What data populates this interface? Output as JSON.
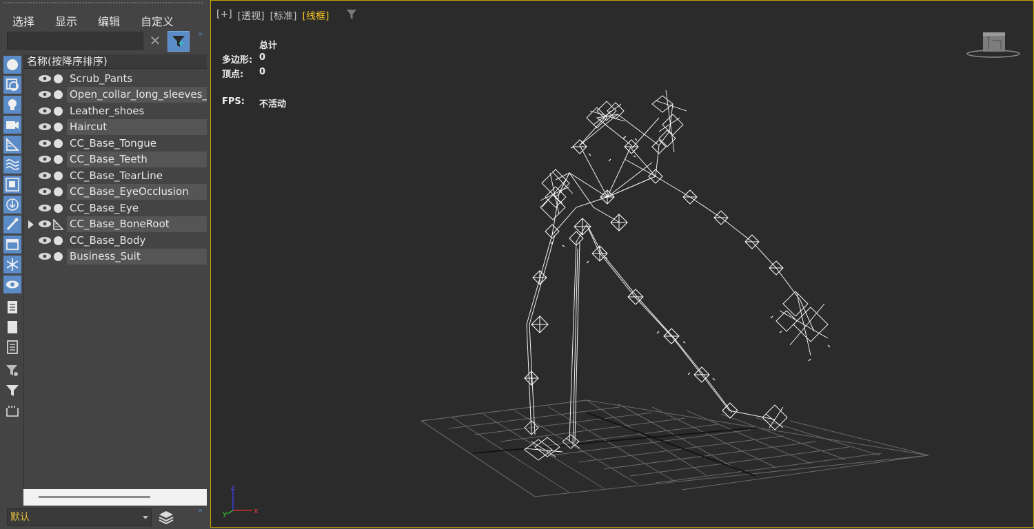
{
  "menu": [
    "选择",
    "显示",
    "编辑",
    "自定义"
  ],
  "search": {
    "value": "",
    "placeholder": ""
  },
  "tree": {
    "header": "名称(按降序排序)",
    "items": [
      {
        "label": "Scrub_Pants",
        "icon": "sphere-icon"
      },
      {
        "label": "Open_collar_long_sleeves_sh",
        "icon": "sphere-icon"
      },
      {
        "label": "Leather_shoes",
        "icon": "sphere-icon"
      },
      {
        "label": "Haircut",
        "icon": "sphere-icon"
      },
      {
        "label": "CC_Base_Tongue",
        "icon": "sphere-icon"
      },
      {
        "label": "CC_Base_Teeth",
        "icon": "sphere-icon"
      },
      {
        "label": "CC_Base_TearLine",
        "icon": "sphere-icon"
      },
      {
        "label": "CC_Base_EyeOcclusion",
        "icon": "sphere-icon"
      },
      {
        "label": "CC_Base_Eye",
        "icon": "sphere-icon"
      },
      {
        "label": "CC_Base_BoneRoot",
        "icon": "bone-icon",
        "expandable": true
      },
      {
        "label": "CC_Base_Body",
        "icon": "sphere-icon"
      },
      {
        "label": "Business_Suit",
        "icon": "sphere-icon"
      }
    ]
  },
  "layer": {
    "value": "默认"
  },
  "viewport": {
    "labels": [
      "[+]",
      "[透视]",
      "[标准]",
      "[线框]"
    ],
    "stats": {
      "header": "总计",
      "polygons_label": "多边形:",
      "polygons_value": "0",
      "vertices_label": "顶点:",
      "vertices_value": "0",
      "fps_label": "FPS:",
      "fps_value": "不活动"
    },
    "axes": {
      "x": "x",
      "y": "y",
      "z": "z"
    }
  },
  "colors": {
    "accent_blue": "#5b8cc8",
    "active_viewport_border": "#c9a200",
    "active_label": "#f0c020",
    "viewport_bg": "#2b2b2b",
    "panel_bg": "#444444"
  }
}
